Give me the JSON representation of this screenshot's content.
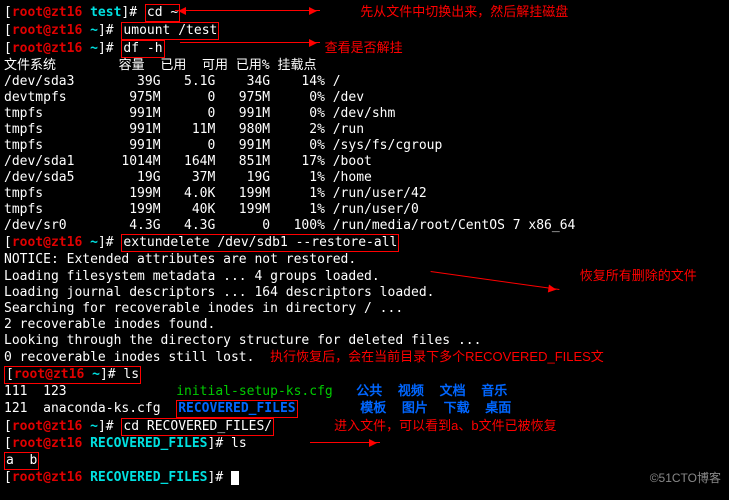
{
  "annotations": {
    "a1": "先从文件中切换出来，然后解挂磁盘",
    "a2": "查看是否解挂",
    "a3": "恢复所有删除的文件",
    "a4": "执行恢复后，会在当前目录下多个RECOVERED_FILES文",
    "a5": "进入文件，可以看到a、b文件已被恢复"
  },
  "prompts": {
    "p1_user": "root@zt16",
    "p1_path": "test",
    "p1_cmd": "cd ~",
    "p2_user": "root@zt16",
    "p2_path": "~",
    "p2_cmd": "umount /test",
    "p3_user": "root@zt16",
    "p3_path": "~",
    "p3_cmd": "df -h",
    "p4_user": "root@zt16",
    "p4_path": "~",
    "p4_cmd": "extundelete /dev/sdb1 --restore-all",
    "p5_user": "root@zt16",
    "p5_path": "~",
    "p5_cmd": "ls",
    "p6_user": "root@zt16",
    "p6_path": "~",
    "p6_cmd": "cd RECOVERED_FILES/",
    "p7_user": "root@zt16",
    "p7_path": "RECOVERED_FILES",
    "p7_cmd": "ls",
    "p8_user": "root@zt16",
    "p8_path": "RECOVERED_FILES",
    "p8_cmd": ""
  },
  "df_header": {
    "c1": "文件系统",
    "c2": "容量",
    "c3": "已用",
    "c4": "可用",
    "c5": "已用%",
    "c6": "挂载点"
  },
  "df": [
    {
      "fs": "/dev/sda3",
      "size": "39G",
      "used": "5.1G",
      "avail": "34G",
      "pct": "14%",
      "mnt": "/"
    },
    {
      "fs": "devtmpfs",
      "size": "975M",
      "used": "0",
      "avail": "975M",
      "pct": "0%",
      "mnt": "/dev"
    },
    {
      "fs": "tmpfs",
      "size": "991M",
      "used": "0",
      "avail": "991M",
      "pct": "0%",
      "mnt": "/dev/shm"
    },
    {
      "fs": "tmpfs",
      "size": "991M",
      "used": "11M",
      "avail": "980M",
      "pct": "2%",
      "mnt": "/run"
    },
    {
      "fs": "tmpfs",
      "size": "991M",
      "used": "0",
      "avail": "991M",
      "pct": "0%",
      "mnt": "/sys/fs/cgroup"
    },
    {
      "fs": "/dev/sda1",
      "size": "1014M",
      "used": "164M",
      "avail": "851M",
      "pct": "17%",
      "mnt": "/boot"
    },
    {
      "fs": "/dev/sda5",
      "size": "19G",
      "used": "37M",
      "avail": "19G",
      "pct": "1%",
      "mnt": "/home"
    },
    {
      "fs": "tmpfs",
      "size": "199M",
      "used": "4.0K",
      "avail": "199M",
      "pct": "1%",
      "mnt": "/run/user/42"
    },
    {
      "fs": "tmpfs",
      "size": "199M",
      "used": "40K",
      "avail": "199M",
      "pct": "1%",
      "mnt": "/run/user/0"
    },
    {
      "fs": "/dev/sr0",
      "size": "4.3G",
      "used": "4.3G",
      "avail": "0",
      "pct": "100%",
      "mnt": "/run/media/root/CentOS 7 x86_64"
    }
  ],
  "ext_output": {
    "l1": "NOTICE: Extended attributes are not restored.",
    "l2": "Loading filesystem metadata ... 4 groups loaded.",
    "l3": "Loading journal descriptors ... 164 descriptors loaded.",
    "l4": "Searching for recoverable inodes in directory / ...",
    "l5": "2 recoverable inodes found.",
    "l6": "Looking through the directory structure for deleted files ...",
    "l7": "0 recoverable inodes still lost."
  },
  "ls1": {
    "r1c1": "111",
    "r1c2": "123",
    "r1c3": "initial-setup-ks.cfg",
    "r1c4": "公共",
    "r1c5": "视频",
    "r1c6": "文档",
    "r1c7": "音乐",
    "r2c1": "121",
    "r2c2": "anaconda-ks.cfg",
    "r2c3": "RECOVERED_FILES",
    "r2c4": "模板",
    "r2c5": "图片",
    "r2c6": "下载",
    "r2c7": "桌面"
  },
  "ls2": {
    "a": "a",
    "b": "b"
  },
  "watermark": "©51CTO博客"
}
